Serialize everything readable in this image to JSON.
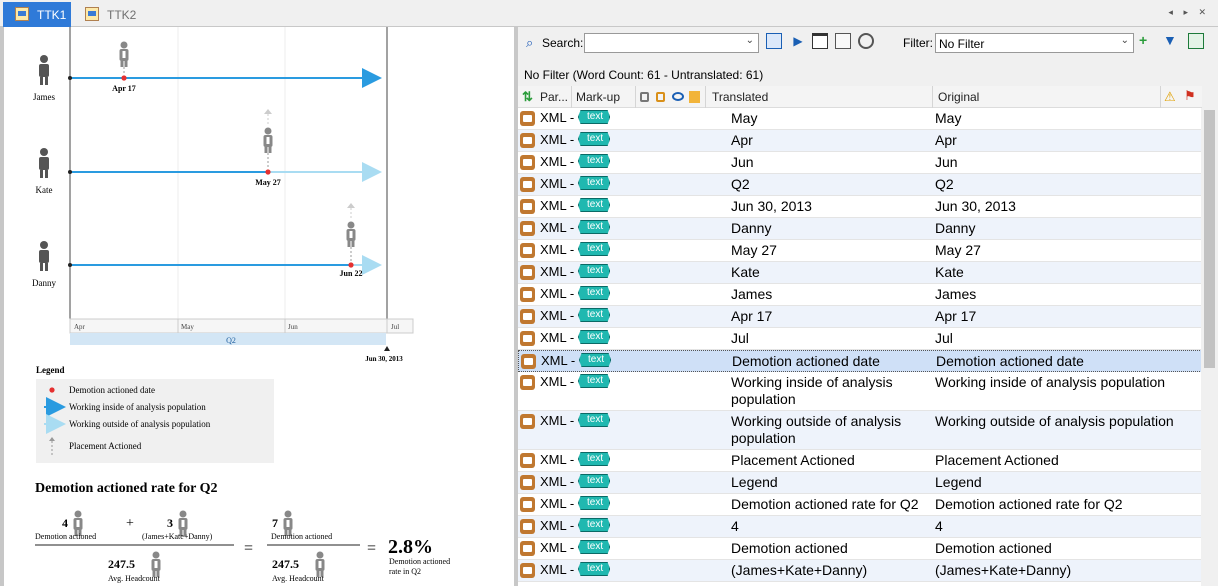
{
  "tabs": [
    {
      "label": "TTK1",
      "active": true
    },
    {
      "label": "TTK2",
      "active": false
    }
  ],
  "tab_controls": "◂ ▸ ✕",
  "toolbar": {
    "search_label": "Search:",
    "search_value": "",
    "filter_label": "Filter:",
    "filter_value": "No Filter"
  },
  "status_text": "No Filter (Word Count: 61 - Untranslated: 61)",
  "columns": {
    "par": "Par...",
    "markup": "Mark-up",
    "translated": "Translated",
    "original": "Original"
  },
  "rows": [
    {
      "par": "XML -",
      "tag": "text",
      "translated": "May",
      "original": "May"
    },
    {
      "par": "XML -",
      "tag": "text",
      "translated": "Apr",
      "original": "Apr"
    },
    {
      "par": "XML -",
      "tag": "text",
      "translated": "Jun",
      "original": "Jun"
    },
    {
      "par": "XML -",
      "tag": "text",
      "translated": "Q2",
      "original": "Q2"
    },
    {
      "par": "XML -",
      "tag": "text",
      "translated": "Jun 30, 2013",
      "original": "Jun 30, 2013"
    },
    {
      "par": "XML -",
      "tag": "text",
      "translated": "Danny",
      "original": "Danny"
    },
    {
      "par": "XML -",
      "tag": "text",
      "translated": "May 27",
      "original": "May 27"
    },
    {
      "par": "XML -",
      "tag": "text",
      "translated": "Kate",
      "original": "Kate"
    },
    {
      "par": "XML -",
      "tag": "text",
      "translated": "James",
      "original": "James"
    },
    {
      "par": "XML -",
      "tag": "text",
      "translated": "Apr 17",
      "original": "Apr 17"
    },
    {
      "par": "XML -",
      "tag": "text",
      "translated": "Jul",
      "original": "Jul"
    },
    {
      "par": "XML -",
      "tag": "text",
      "translated": "Demotion actioned date",
      "original": "Demotion actioned date"
    },
    {
      "par": "XML -",
      "tag": "text",
      "translated": "Working inside of analysis population",
      "original": "Working inside of analysis population"
    },
    {
      "par": "XML -",
      "tag": "text",
      "translated": "Working outside of analysis population",
      "original": "Working outside of analysis population"
    },
    {
      "par": "XML -",
      "tag": "text",
      "translated": "Placement Actioned",
      "original": "Placement Actioned"
    },
    {
      "par": "XML -",
      "tag": "text",
      "translated": "Legend",
      "original": "Legend"
    },
    {
      "par": "XML -",
      "tag": "text",
      "translated": "Demotion actioned rate for Q2",
      "original": "Demotion actioned rate for Q2"
    },
    {
      "par": "XML -",
      "tag": "text",
      "translated": "4",
      "original": "4"
    },
    {
      "par": "XML -",
      "tag": "text",
      "translated": "Demotion actioned",
      "original": "Demotion actioned"
    },
    {
      "par": "XML -",
      "tag": "text",
      "translated": "(James+Kate+Danny)",
      "original": "(James+Kate+Danny)"
    }
  ],
  "preview": {
    "people": [
      "James",
      "Kate",
      "Danny"
    ],
    "event_labels": [
      "Apr 17",
      "May 27",
      "Jun 22"
    ],
    "months": [
      "Apr",
      "May",
      "Jun",
      "Jul"
    ],
    "quarter": "Q2",
    "end_date": "Jun 30, 2013",
    "legend_title": "Legend",
    "legend_items": [
      "Demotion actioned date",
      "Working inside of analysis population",
      "Working outside of analysis population",
      "Placement Actioned"
    ],
    "rate_title": "Demotion actioned rate for Q2",
    "num1": "4",
    "label_da1": "Demotion actioned",
    "plus": "+",
    "num2": "3",
    "label_jkd": "(James+Kate+Danny)",
    "num3": "7",
    "label_da2": "Demotion actioned",
    "den1": "247.5",
    "den_label1": "Avg. Headcount",
    "den2": "247.5",
    "den_label2": "Avg. Headcount",
    "eq1": "=",
    "eq2": "=",
    "rate": "2.8%",
    "rate_label1": "Demotion actioned",
    "rate_label2": "rate in Q2"
  },
  "colors": {
    "tab_active": "#2f7ad8",
    "arrow_inside": "#2a9be0",
    "arrow_outside": "#a9dcf2",
    "demotion_dot": "#e53030",
    "selected_row": "#cfe0f7"
  }
}
